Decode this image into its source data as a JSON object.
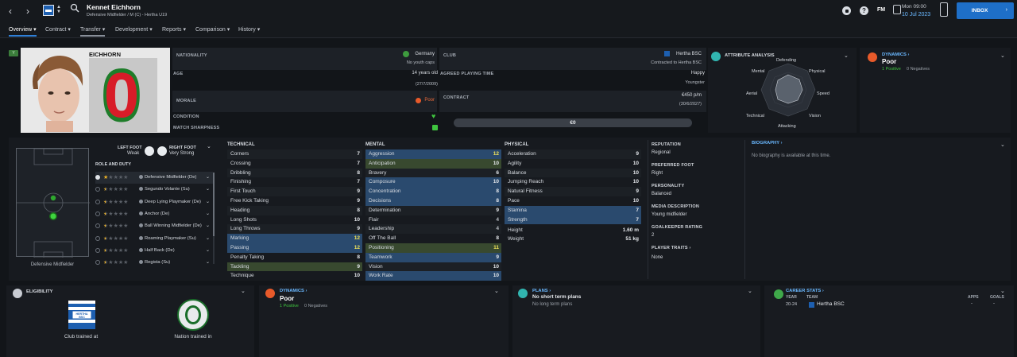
{
  "header": {
    "player_name": "Kennet Eichhorn",
    "player_sub": "Defensive Midfielder / M (C) - Hertha U19",
    "time": "Mon 09:00",
    "date": "10 Jul 2023",
    "fm_label": "FM",
    "inbox_label": "INBOX"
  },
  "tabs": [
    "Overview",
    "Contract",
    "Transfer",
    "Development",
    "Reports",
    "Comparison",
    "History"
  ],
  "shirt": {
    "name": "EICHHORN",
    "number": "0",
    "badge": "Y"
  },
  "info": {
    "nationality_label": "NATIONALITY",
    "nationality": "Germany",
    "youth_caps": "No youth caps",
    "club_label": "CLUB",
    "club": "Hertha BSC",
    "contracted_to": "Contracted to Hertha BSC",
    "age_label": "AGE",
    "age": "14 years old",
    "dob": "(27/7/2009)",
    "apt_label": "AGREED PLAYING TIME",
    "apt": "Happy",
    "apt_role": "Youngster",
    "morale_label": "MORALE",
    "morale": "Poor",
    "contract_label": "CONTRACT",
    "wage": "€450 p/m",
    "contract_end": "(30/6/2027)",
    "condition_label": "CONDITION",
    "sharpness_label": "MATCH SHARPNESS",
    "value": "€0"
  },
  "attr_analysis": {
    "title": "ATTRIBUTE ANALYSIS",
    "labels": [
      "Defending",
      "Physical",
      "Speed",
      "Vision",
      "Attacking",
      "Technical",
      "Aerial",
      "Mental"
    ]
  },
  "dynamics_top": {
    "title": "DYNAMICS",
    "value": "Poor",
    "positive": "1 Positive",
    "negatives": "0 Negatives"
  },
  "pitch": {
    "position": "Defensive Midfielder"
  },
  "feet": {
    "left_label": "LEFT FOOT",
    "left": "Weak",
    "right_label": "RIGHT FOOT",
    "right": "Very Strong"
  },
  "roles_title": "ROLE AND DUTY",
  "roles": [
    {
      "name": "Defensive Midfielder (De)",
      "stars": 1.0
    },
    {
      "name": "Segundo Volante (Su)",
      "stars": 0.5
    },
    {
      "name": "Deep Lying Playmaker (De)",
      "stars": 0.5
    },
    {
      "name": "Anchor (De)",
      "stars": 0.5
    },
    {
      "name": "Ball Winning Midfielder (De)",
      "stars": 0.5
    },
    {
      "name": "Roaming Playmaker (Su)",
      "stars": 0.5
    },
    {
      "name": "Half Back (De)",
      "stars": 0.5
    },
    {
      "name": "Regista (Su)",
      "stars": 0.5
    }
  ],
  "technical_title": "TECHNICAL",
  "technical": [
    {
      "name": "Corners",
      "value": "7",
      "hl": ""
    },
    {
      "name": "Crossing",
      "value": "7",
      "hl": ""
    },
    {
      "name": "Dribbling",
      "value": "8",
      "hl": ""
    },
    {
      "name": "Finishing",
      "value": "7",
      "hl": ""
    },
    {
      "name": "First Touch",
      "value": "9",
      "hl": ""
    },
    {
      "name": "Free Kick Taking",
      "value": "9",
      "hl": ""
    },
    {
      "name": "Heading",
      "value": "8",
      "hl": ""
    },
    {
      "name": "Long Shots",
      "value": "10",
      "hl": ""
    },
    {
      "name": "Long Throws",
      "value": "9",
      "hl": ""
    },
    {
      "name": "Marking",
      "value": "12",
      "hl": "blue"
    },
    {
      "name": "Passing",
      "value": "12",
      "hl": "blue"
    },
    {
      "name": "Penalty Taking",
      "value": "8",
      "hl": ""
    },
    {
      "name": "Tackling",
      "value": "9",
      "hl": "green"
    },
    {
      "name": "Technique",
      "value": "10",
      "hl": ""
    }
  ],
  "mental_title": "MENTAL",
  "mental": [
    {
      "name": "Aggression",
      "value": "12",
      "hl": "blue"
    },
    {
      "name": "Anticipation",
      "value": "10",
      "hl": "green"
    },
    {
      "name": "Bravery",
      "value": "6",
      "hl": ""
    },
    {
      "name": "Composure",
      "value": "10",
      "hl": "blue"
    },
    {
      "name": "Concentration",
      "value": "8",
      "hl": "blue"
    },
    {
      "name": "Decisions",
      "value": "8",
      "hl": "blue"
    },
    {
      "name": "Determination",
      "value": "9",
      "hl": ""
    },
    {
      "name": "Flair",
      "value": "4",
      "hl": ""
    },
    {
      "name": "Leadership",
      "value": "4",
      "hl": ""
    },
    {
      "name": "Off The Ball",
      "value": "8",
      "hl": ""
    },
    {
      "name": "Positioning",
      "value": "11",
      "hl": "green"
    },
    {
      "name": "Teamwork",
      "value": "9",
      "hl": "blue"
    },
    {
      "name": "Vision",
      "value": "10",
      "hl": ""
    },
    {
      "name": "Work Rate",
      "value": "10",
      "hl": "blue"
    }
  ],
  "physical_title": "PHYSICAL",
  "physical": [
    {
      "name": "Acceleration",
      "value": "9",
      "hl": ""
    },
    {
      "name": "Agility",
      "value": "10",
      "hl": ""
    },
    {
      "name": "Balance",
      "value": "10",
      "hl": ""
    },
    {
      "name": "Jumping Reach",
      "value": "10",
      "hl": ""
    },
    {
      "name": "Natural Fitness",
      "value": "9",
      "hl": ""
    },
    {
      "name": "Pace",
      "value": "10",
      "hl": ""
    },
    {
      "name": "Stamina",
      "value": "7",
      "hl": "blue"
    },
    {
      "name": "Strength",
      "value": "7",
      "hl": "blue"
    }
  ],
  "body": {
    "height_label": "Height",
    "height": "1.60 m",
    "weight_label": "Weight",
    "weight": "51 kg"
  },
  "profile": {
    "reputation_label": "REPUTATION",
    "reputation": "Regional",
    "foot_label": "PREFERRED FOOT",
    "foot": "Right",
    "personality_label": "PERSONALITY",
    "personality": "Balanced",
    "media_label": "MEDIA DESCRIPTION",
    "media": "Young midfielder",
    "gk_label": "GOALKEEPER RATING",
    "gk": "2",
    "traits_label": "PLAYER TRAITS",
    "traits": "None"
  },
  "biography": {
    "title": "BIOGRAPHY",
    "text": "No biography is available at this time."
  },
  "eligibility": {
    "title": "ELIGIBILITY",
    "club_trained": "Club trained at",
    "nation_trained": "Nation trained in",
    "club_crest": "HERTHA BSC"
  },
  "dynamics_bottom": {
    "title": "DYNAMICS",
    "value": "Poor",
    "positive": "1 Positive",
    "negatives": "0 Negatives"
  },
  "plans": {
    "title": "PLANS",
    "short": "No short term plans",
    "long": "No long term plans"
  },
  "career": {
    "title": "CAREER STATS",
    "col_year": "YEAR",
    "col_team": "TEAM",
    "col_apps": "APPS",
    "col_goals": "GOALS",
    "year": "20-24",
    "team": "Hertha BSC",
    "apps": "-",
    "goals": "-"
  },
  "colors": {
    "accent": "#2f7fd6",
    "inbox": "#1e6fc8",
    "green": "#3fc43f",
    "orange": "#e85a2a",
    "teal": "#31b5b0",
    "highlight_blue": "#2a4a6e",
    "highlight_green": "#38492f"
  }
}
